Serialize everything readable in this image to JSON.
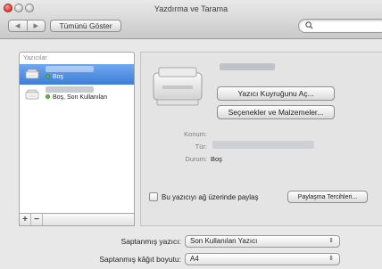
{
  "window": {
    "title": "Yazdırma ve Tarama"
  },
  "toolbar": {
    "back_icon": "◀",
    "forward_icon": "▶",
    "show_all_label": "Tümünü Göster",
    "search_placeholder": ""
  },
  "printer_list": {
    "header": "Yazıcılar",
    "items": [
      {
        "status": "Boş",
        "selected": true
      },
      {
        "status": "Boş, Son Kullanılan",
        "selected": false
      }
    ],
    "add_label": "+",
    "remove_label": "−"
  },
  "details": {
    "open_queue_label": "Yazıcı Kuyruğunu Aç...",
    "options_label": "Seçenekler ve Malzemeler...",
    "location_label": "Konum:",
    "kind_label": "Tür:",
    "status_label": "Durum:",
    "status_value": "Boş"
  },
  "sharing": {
    "checkbox_label": "Bu yazıcıyı ağ üzerinde paylaş",
    "preferences_label": "Paylaşma Tercihleri..."
  },
  "defaults": {
    "printer_label": "Saptanmış yazıcı:",
    "printer_value": "Son Kullanılan Yazıcı",
    "paper_label": "Saptanmış kâğıt boyutu:",
    "paper_value": "A4"
  },
  "colors": {
    "selection": "#3e7ed9",
    "status_green": "#5bc236",
    "close_red": "#e0443a"
  },
  "icons": {
    "search": "magnifier-icon",
    "printer": "printer-icon",
    "popup": "updown-arrows-icon"
  }
}
